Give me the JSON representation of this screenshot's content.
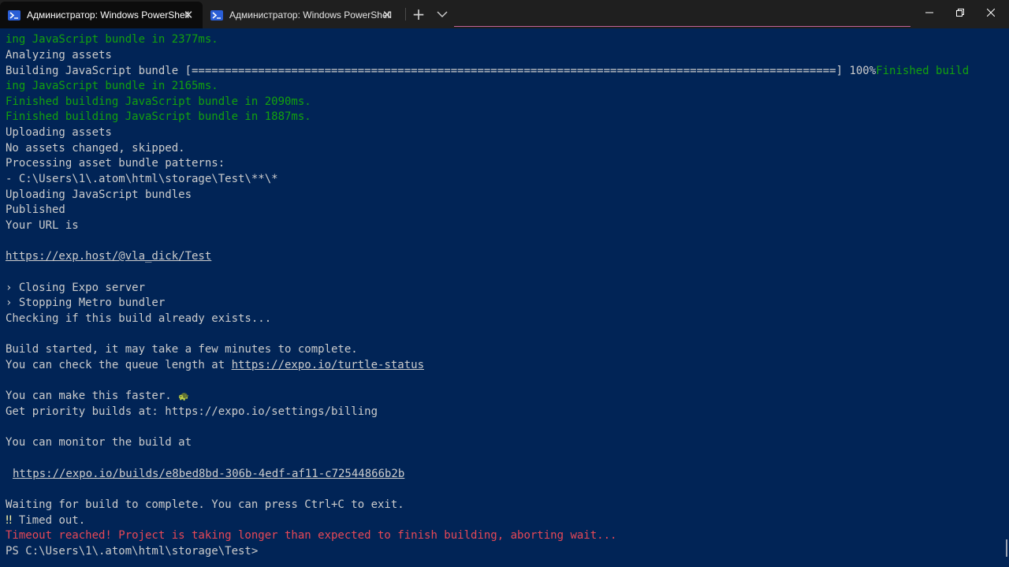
{
  "window": {
    "tabs": [
      {
        "label": "Администратор: Windows PowerShell",
        "active": true
      },
      {
        "label": "Администратор: Windows PowerShell",
        "active": false
      }
    ],
    "new_tab_symbol": "+",
    "close_symbol": "✕"
  },
  "terminal": {
    "background": "#012456",
    "lines": {
      "l1": "ing JavaScript bundle in 2377ms.",
      "l2": "Analyzing assets",
      "l3a": "Building JavaScript bundle [=================================================================================================] 100%",
      "l3b": "Finished build",
      "l4": "ing JavaScript bundle in 2165ms.",
      "l5": "Finished building JavaScript bundle in 2090ms.",
      "l6": "Finished building JavaScript bundle in 1887ms.",
      "l7": "Uploading assets",
      "l8": "No assets changed, skipped.",
      "l9": "Processing asset bundle patterns:",
      "l10": "- C:\\Users\\1\\.atom\\html\\storage\\Test\\**\\*",
      "l11": "Uploading JavaScript bundles",
      "l12": "Published",
      "l13": "Your URL is",
      "l15": "https://exp.host/@vla_dick/Test",
      "l17": "› Closing Expo server",
      "l18": "› Stopping Metro bundler",
      "l19": "Checking if this build already exists...",
      "l21": "Build started, it may take a few minutes to complete.",
      "l22a": "You can check the queue length at ",
      "l22b": "https://expo.io/turtle-status",
      "l24": "You can make this faster. ",
      "l24_emoji": "🐢",
      "l25": "Get priority builds at: https://expo.io/settings/billing",
      "l27": "You can monitor the build at",
      "l29": "https://expo.io/builds/e8bed8bd-306b-4edf-af11-c72544866b2b",
      "l31": "Waiting for build to complete. You can press Ctrl+C to exit.",
      "l32a": "‼",
      "l32b": " Timed out.",
      "l33": "Timeout reached! Project is taking longer than expected to finish building, aborting wait...",
      "l34": "PS C:\\Users\\1\\.atom\\html\\storage\\Test>"
    }
  }
}
